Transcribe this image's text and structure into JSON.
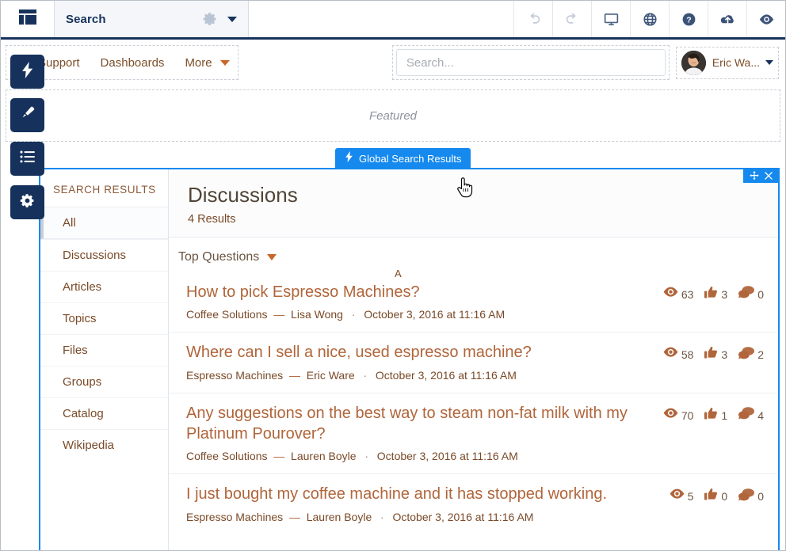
{
  "builder": {
    "logo_icon": "layout-template-icon",
    "tab_label": "Search",
    "gear_icon": "gear-icon",
    "caret_icon": "chevron-down-icon",
    "tools": [
      {
        "name": "undo-button",
        "icon": "undo-icon",
        "disabled": true
      },
      {
        "name": "redo-button",
        "icon": "redo-icon",
        "disabled": true
      },
      {
        "name": "desktop-preview-button",
        "icon": "monitor-icon",
        "disabled": false
      },
      {
        "name": "globe-button",
        "icon": "globe-icon",
        "disabled": false
      },
      {
        "name": "help-button",
        "icon": "question-circle-icon",
        "disabled": false
      },
      {
        "name": "publish-button",
        "icon": "cloud-upload-icon",
        "disabled": false
      },
      {
        "name": "preview-button",
        "icon": "eye-icon",
        "disabled": false
      }
    ]
  },
  "left_tools": [
    {
      "name": "lightning-tool",
      "icon": "lightning-bolt-icon"
    },
    {
      "name": "theme-tool",
      "icon": "paintbrush-icon"
    },
    {
      "name": "pages-tool",
      "icon": "list-icon",
      "active": true
    },
    {
      "name": "settings-tool",
      "icon": "gear-icon"
    }
  ],
  "site_header": {
    "nav": [
      {
        "label": "Support"
      },
      {
        "label": "Dashboards"
      },
      {
        "label": "More",
        "has_caret": true
      }
    ],
    "search_placeholder": "Search...",
    "user_name": "Eric Wa...",
    "avatar_icon": "avatar"
  },
  "featured": {
    "label": "Featured"
  },
  "component_tab": {
    "icon": "lightning-bolt-icon",
    "label": "Global Search Results"
  },
  "panel": {
    "move_icon": "move-icon",
    "close_icon": "close-icon"
  },
  "search_results": {
    "sidebar_title": "SEARCH RESULTS",
    "sidebar_items": [
      {
        "label": "All",
        "active": true
      },
      {
        "label": "Discussions",
        "active": false
      },
      {
        "label": "Articles",
        "active": false
      },
      {
        "label": "Topics",
        "active": false
      },
      {
        "label": "Files",
        "active": false
      },
      {
        "label": "Groups",
        "active": false
      },
      {
        "label": "Catalog",
        "active": false
      },
      {
        "label": "Wikipedia",
        "active": false
      }
    ],
    "heading": "Discussions",
    "count_label": "4 Results",
    "sort_label": "Top Questions",
    "sort_caret": "chevron-down-icon",
    "marker_a": "A",
    "rows": [
      {
        "title": "How to pick Espresso Machines?",
        "topic": "Coffee Solutions",
        "author": "Lisa Wong",
        "date": "October 3, 2016 at 11:16 AM",
        "views": "63",
        "likes": "3",
        "comments": "0"
      },
      {
        "title": "Where can I sell a nice, used espresso machine?",
        "topic": "Espresso Machines",
        "author": "Eric Ware",
        "date": "October 3, 2016 at 11:16 AM",
        "views": "58",
        "likes": "3",
        "comments": "2"
      },
      {
        "title": "Any suggestions on the best way to steam non-fat milk with my Platinum Pourover?",
        "topic": "Coffee Solutions",
        "author": "Lauren Boyle",
        "date": "October 3, 2016 at 11:16 AM",
        "views": "70",
        "likes": "1",
        "comments": "4"
      },
      {
        "title": "I just bought my coffee machine and it has stopped working.",
        "topic": "Espresso Machines",
        "author": "Lauren Boyle",
        "date": "October 3, 2016 at 11:16 AM",
        "views": "5",
        "likes": "0",
        "comments": "0"
      }
    ]
  },
  "colors": {
    "brand_navy": "#16325c",
    "accent_blue": "#1589ee",
    "terracotta": "#b0653a",
    "link_brown": "#7a4a28"
  }
}
